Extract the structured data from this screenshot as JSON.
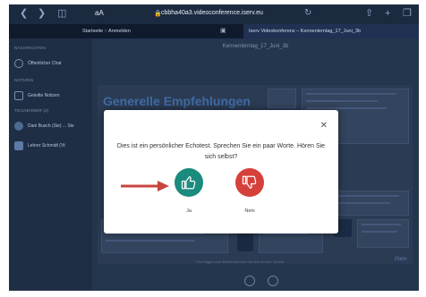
{
  "browser": {
    "text_size": "aA",
    "url": "cbbha40a3.videoconference.iserv.eu",
    "tabs": [
      {
        "label": "Startseite :: Anmelden"
      },
      {
        "label": "Iserv Videokonferenz – Kennenlerntag_17_Juni_3b"
      }
    ]
  },
  "sidebar": {
    "section_messages": "NACHRICHTEN",
    "public_chat": "Öffentlicher Chat",
    "section_notes": "NOTIZEN",
    "shared_notes": "Geteilte Notizen",
    "section_participants": "TEILNEHMER (2)",
    "participants": [
      {
        "name": "Dani Busch (Sie) ... Sie"
      },
      {
        "name": "Lehrer Schmidt (Vt"
      }
    ]
  },
  "main": {
    "room_title": "Kennenlerntag_17_Juni_3b",
    "slide_title": "Generelle Empfehlungen",
    "slide_note": "Für Fragen zum Beitritt wenden Sie sich an Ihre Schule",
    "brand": "iServ"
  },
  "modal": {
    "prompt": "Dies ist ein persönlicher Echotest. Sprechen Sie ein paar Worte. Hören Sie sich selbst?",
    "yes_label": "Ja",
    "no_label": "Nein"
  },
  "colors": {
    "yes": "#1b8b7e",
    "no": "#d6403a",
    "arrow": "#c8443d"
  }
}
